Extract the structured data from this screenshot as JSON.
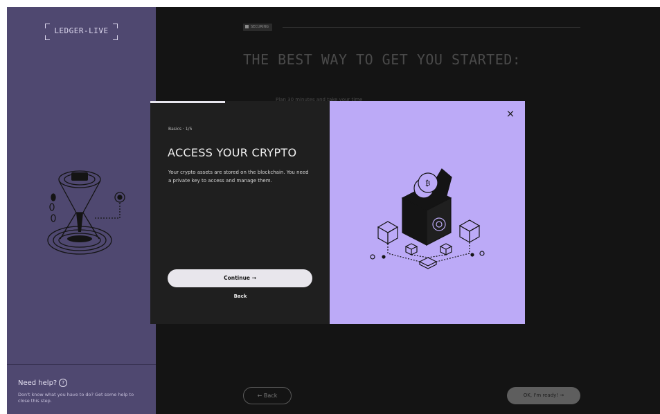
{
  "app": {
    "logo_text": "LEDGER-LIVE"
  },
  "sidebar": {
    "help_title": "Need help?",
    "help_text": "Don't know what you have to do? Get some help to close this step."
  },
  "main": {
    "step_badge": "SECURING",
    "title": "THE BEST WAY TO GET YOU STARTED:",
    "bg_item_text": "Plan 30 minutes and take your time",
    "back_label": "← Back",
    "ready_label": "OK, I'm ready! →"
  },
  "modal": {
    "breadcrumb": "Basics · 1/5",
    "title": "ACCESS YOUR CRYPTO",
    "description": "Your crypto assets are stored on the blockchain. You need a private key to access and manage them.",
    "continue_label": "Continue →",
    "back_label": "Back",
    "close_icon": "×"
  },
  "colors": {
    "sidebar_bg": "#4f4870",
    "main_bg": "#141414",
    "modal_bg": "#1f1f1f",
    "accent_lavender": "#bcaaf7"
  },
  "icons": [
    "hourglass-illustration",
    "crypto-box-illustration",
    "close-icon",
    "arrow-right-icon",
    "arrow-left-icon",
    "help-icon"
  ]
}
